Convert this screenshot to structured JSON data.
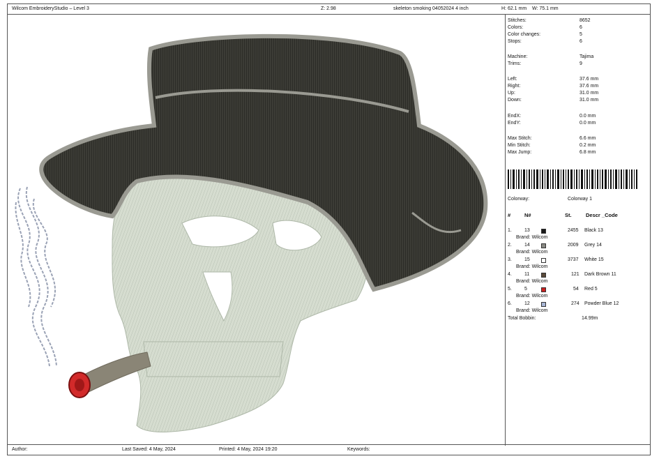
{
  "header": {
    "app_title": "Wilcom EmbroideryStudio – Level 3",
    "zoom": "Z: 2.98",
    "design_name": "skeleton smoking 04052024 4 inch",
    "height": "H: 62.1 mm",
    "width": "W: 75.1 mm"
  },
  "footer": {
    "author": "Author:",
    "last_saved": "Last Saved:  4 May, 2024",
    "printed": "Printed:  4 May, 2024 19:20",
    "keywords": "Keywords:"
  },
  "stats": [
    {
      "k": "Stitches:",
      "v": "8652"
    },
    {
      "k": "Colors:",
      "v": "6"
    },
    {
      "k": "Color changes:",
      "v": "5"
    },
    {
      "k": "Stops:",
      "v": "6"
    },
    {
      "k": "Machine:",
      "v": "Tajima"
    },
    {
      "k": "Trims:",
      "v": "9"
    },
    {
      "k": "Left:",
      "v": "37.6 mm"
    },
    {
      "k": "Right:",
      "v": "37.6 mm"
    },
    {
      "k": "Up:",
      "v": "31.0 mm"
    },
    {
      "k": "Down:",
      "v": "31.0 mm"
    },
    {
      "k": "EndX:",
      "v": "0.0 mm"
    },
    {
      "k": "EndY:",
      "v": "0.0 mm"
    },
    {
      "k": "Max Stitch:",
      "v": "6.6 mm"
    },
    {
      "k": "Min Stitch:",
      "v": "0.2 mm"
    },
    {
      "k": "Max Jump:",
      "v": "6.8 mm"
    }
  ],
  "colorway": {
    "label": "Colorway:",
    "value": "Colorway 1"
  },
  "table": {
    "headers": [
      "#",
      "N#",
      "St.",
      "Descr _Code"
    ],
    "rows": [
      {
        "num": "1.",
        "n": "13",
        "st": "2455",
        "desc": "Black 13",
        "brand": "Brand: Wilcom",
        "color": "#1a1a1a"
      },
      {
        "num": "2.",
        "n": "14",
        "st": "2009",
        "desc": "Grey 14",
        "brand": "Brand: Wilcom",
        "color": "#8a8a84"
      },
      {
        "num": "3.",
        "n": "15",
        "st": "3737",
        "desc": "White 15",
        "brand": "Brand: Wilcom",
        "color": "#ffffff"
      },
      {
        "num": "4.",
        "n": "11",
        "st": "121",
        "desc": "Dark Brown 11",
        "brand": "Brand: Wilcom",
        "color": "#5a4a3a"
      },
      {
        "num": "5.",
        "n": "5",
        "st": "54",
        "desc": "Red 5",
        "brand": "Brand: Wilcom",
        "color": "#cc2222"
      },
      {
        "num": "6.",
        "n": "12",
        "st": "274",
        "desc": "Powder Blue 12",
        "brand": "Brand: Wilcom",
        "color": "#a9b7d6"
      }
    ],
    "total_label": "Total Bobbin:",
    "total_value": "14.99m"
  }
}
